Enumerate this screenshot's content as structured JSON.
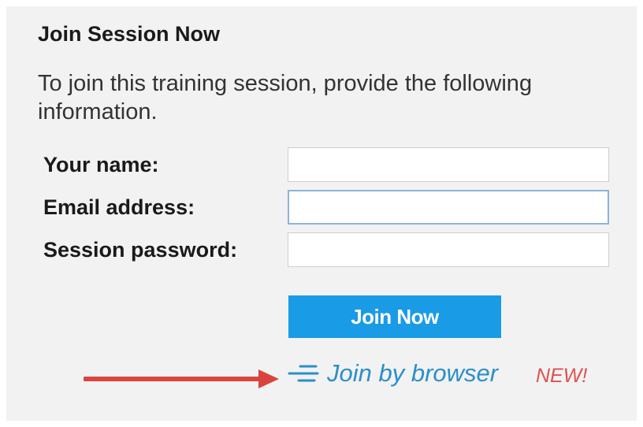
{
  "form": {
    "title": "Join Session Now",
    "description": "To join this training session, provide the following information.",
    "fields": [
      {
        "label": "Your name:",
        "value": ""
      },
      {
        "label": "Email address:",
        "value": ""
      },
      {
        "label": "Session password:",
        "value": ""
      }
    ],
    "submit_label": "Join Now",
    "browser_link": {
      "icon": "speed-lines-icon",
      "label": "Join by browser",
      "badge": "NEW!"
    }
  },
  "colors": {
    "panel_bg": "#f2f2f2",
    "button_bg": "#1a9be6",
    "link": "#2a8fc9",
    "badge": "#e05050",
    "annotation_arrow": "#d9453e"
  }
}
